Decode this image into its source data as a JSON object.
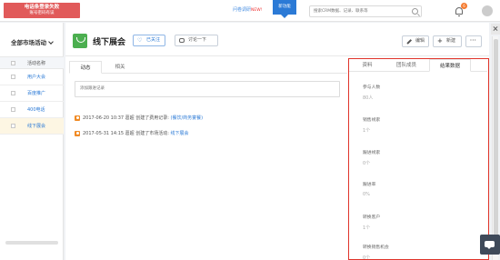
{
  "alert": {
    "line1": "电话条登录失败",
    "line2": "账号密码有误"
  },
  "topbar": {
    "survey_text": "问卷调研",
    "survey_new": "NEW!",
    "new_feature": "新功能",
    "search_placeholder": "搜索CRM数据、记录、联系等",
    "notification_count": "6"
  },
  "left_panel": {
    "filter_label": "全部市场活动",
    "column_header": "活动名称",
    "items": [
      {
        "label": "用户大会",
        "active": false
      },
      {
        "label": "百度推广",
        "active": false
      },
      {
        "label": "400电话",
        "active": false
      },
      {
        "label": "线下展会",
        "active": true
      }
    ]
  },
  "detail": {
    "title": "线下展会",
    "follow_label": "已关注",
    "comment_label": "讨论一下",
    "edit_label": "编辑",
    "new_label": "新建",
    "more_label": "···"
  },
  "activity": {
    "tabs": [
      "动态",
      "相关"
    ],
    "input_placeholder": "添加跟进记录",
    "logs": [
      {
        "text": "2017-06-20 10:37 葛超 创建了费用记录: ",
        "link": "(餐饮/商务宴餐)"
      },
      {
        "text": "2017-05-31 14:15 葛超 创建了市场活动: ",
        "link": "线下展会"
      }
    ]
  },
  "results": {
    "tabs": [
      "资料",
      "团队成员",
      "结果数据"
    ],
    "stats": [
      {
        "label": "参与人数",
        "value": "80人"
      },
      {
        "label": "销售线索",
        "value": "1个"
      },
      {
        "label": "跟进线索",
        "value": "0个"
      },
      {
        "label": "跟进率",
        "value": "0%"
      },
      {
        "label": "转换客户",
        "value": "1个"
      },
      {
        "label": "转换销售机会",
        "value": "0个"
      }
    ]
  }
}
